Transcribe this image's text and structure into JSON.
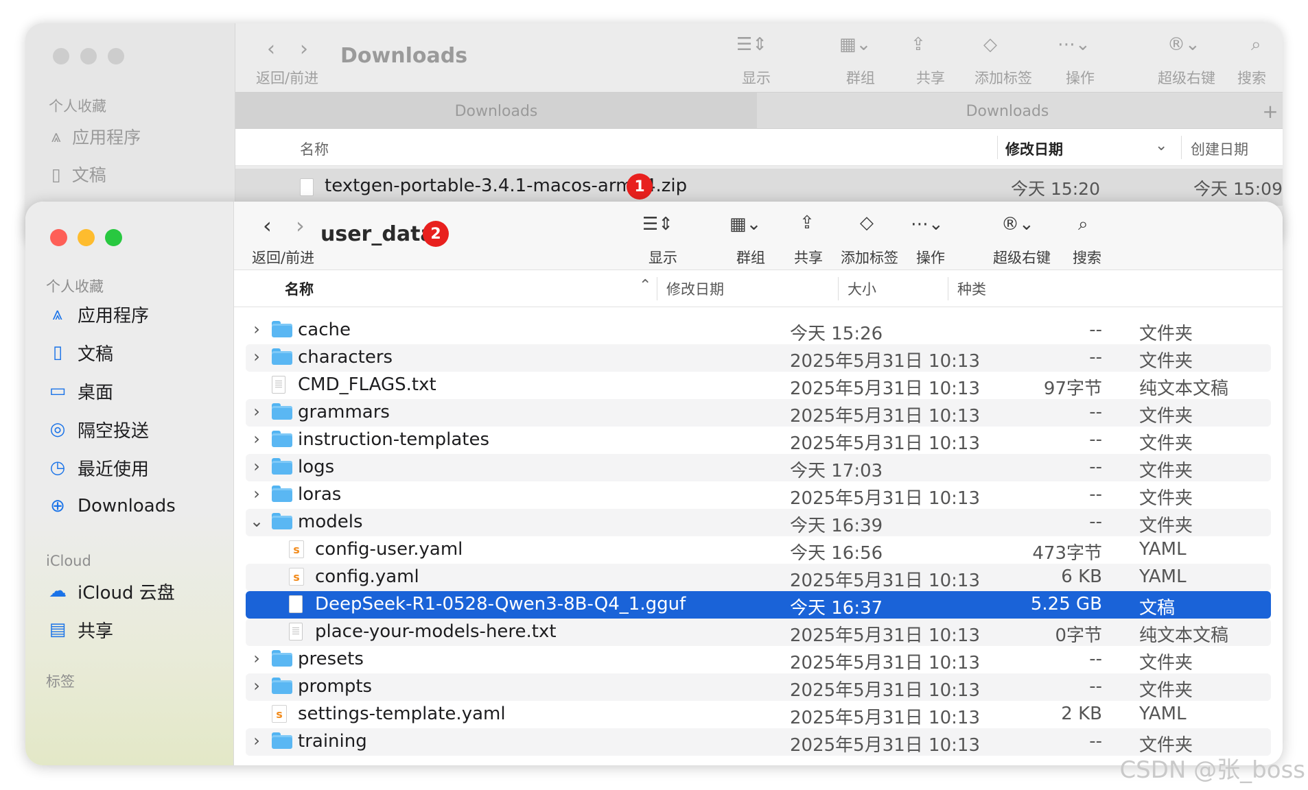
{
  "back_window": {
    "sidebar_heading": "个人收藏",
    "sidebar_items": [
      {
        "label": "应用程序",
        "icon": "apps-icon"
      },
      {
        "label": "文稿",
        "icon": "doc-icon"
      }
    ],
    "title": "Downloads",
    "nav_label": "返回/前进",
    "toolbar": [
      "显示",
      "群组",
      "共享",
      "添加标签",
      "操作",
      "超级右键",
      "搜索"
    ],
    "tabs": [
      "Downloads",
      "Downloads"
    ],
    "add_tab": "+",
    "columns": {
      "name": "名称",
      "modified": "修改日期",
      "created": "创建日期"
    },
    "row": {
      "name": "textgen-portable-3.4.1-macos-arm64.zip",
      "modified": "今天 15:20",
      "created": "今天 15:09"
    },
    "badge": "1"
  },
  "front_window": {
    "sidebar": {
      "favorites_heading": "个人收藏",
      "favorites": [
        {
          "label": "应用程序",
          "icon": "apps-icon"
        },
        {
          "label": "文稿",
          "icon": "doc-icon"
        },
        {
          "label": "桌面",
          "icon": "desktop-icon"
        },
        {
          "label": "隔空投送",
          "icon": "airdrop-icon"
        },
        {
          "label": "最近使用",
          "icon": "clock-icon"
        },
        {
          "label": "Downloads",
          "icon": "download-icon"
        }
      ],
      "icloud_heading": "iCloud",
      "icloud": [
        {
          "label": "iCloud 云盘",
          "icon": "cloud-icon"
        },
        {
          "label": "共享",
          "icon": "shared-folder-icon"
        }
      ],
      "tags_heading": "标签"
    },
    "title": "user_data",
    "badge": "2",
    "nav_label": "返回/前进",
    "toolbar": [
      "显示",
      "群组",
      "共享",
      "添加标签",
      "操作",
      "超级右键",
      "搜索"
    ],
    "columns": {
      "name": "名称",
      "modified": "修改日期",
      "size": "大小",
      "kind": "种类"
    },
    "rows": [
      {
        "name": "cache",
        "modified": "今天 15:26",
        "size": "--",
        "kind": "文件夹",
        "type": "folder",
        "depth": 0,
        "expand": "collapsed"
      },
      {
        "name": "characters",
        "modified": "2025年5月31日 10:13",
        "size": "--",
        "kind": "文件夹",
        "type": "folder",
        "depth": 0,
        "expand": "collapsed"
      },
      {
        "name": "CMD_FLAGS.txt",
        "modified": "2025年5月31日 10:13",
        "size": "97字节",
        "kind": "纯文本文稿",
        "type": "txt",
        "depth": 0,
        "expand": "none"
      },
      {
        "name": "grammars",
        "modified": "2025年5月31日 10:13",
        "size": "--",
        "kind": "文件夹",
        "type": "folder",
        "depth": 0,
        "expand": "collapsed"
      },
      {
        "name": "instruction-templates",
        "modified": "2025年5月31日 10:13",
        "size": "--",
        "kind": "文件夹",
        "type": "folder",
        "depth": 0,
        "expand": "collapsed"
      },
      {
        "name": "logs",
        "modified": "今天 17:03",
        "size": "--",
        "kind": "文件夹",
        "type": "folder",
        "depth": 0,
        "expand": "collapsed"
      },
      {
        "name": "loras",
        "modified": "2025年5月31日 10:13",
        "size": "--",
        "kind": "文件夹",
        "type": "folder",
        "depth": 0,
        "expand": "collapsed"
      },
      {
        "name": "models",
        "modified": "今天 16:39",
        "size": "--",
        "kind": "文件夹",
        "type": "folder",
        "depth": 0,
        "expand": "expanded"
      },
      {
        "name": "config-user.yaml",
        "modified": "今天 16:56",
        "size": "473字节",
        "kind": "YAML",
        "type": "yaml",
        "depth": 1,
        "expand": "none"
      },
      {
        "name": "config.yaml",
        "modified": "2025年5月31日 10:13",
        "size": "6 KB",
        "kind": "YAML",
        "type": "yaml",
        "depth": 1,
        "expand": "none"
      },
      {
        "name": "DeepSeek-R1-0528-Qwen3-8B-Q4_1.gguf",
        "modified": "今天 16:37",
        "size": "5.25 GB",
        "kind": "文稿",
        "type": "doc",
        "depth": 1,
        "expand": "none",
        "selected": true
      },
      {
        "name": "place-your-models-here.txt",
        "modified": "2025年5月31日 10:13",
        "size": "0字节",
        "kind": "纯文本文稿",
        "type": "txt",
        "depth": 1,
        "expand": "none"
      },
      {
        "name": "presets",
        "modified": "2025年5月31日 10:13",
        "size": "--",
        "kind": "文件夹",
        "type": "folder",
        "depth": 0,
        "expand": "collapsed"
      },
      {
        "name": "prompts",
        "modified": "2025年5月31日 10:13",
        "size": "--",
        "kind": "文件夹",
        "type": "folder",
        "depth": 0,
        "expand": "collapsed"
      },
      {
        "name": "settings-template.yaml",
        "modified": "2025年5月31日 10:13",
        "size": "2 KB",
        "kind": "YAML",
        "type": "yaml",
        "depth": 0,
        "expand": "none"
      },
      {
        "name": "training",
        "modified": "2025年5月31日 10:13",
        "size": "--",
        "kind": "文件夹",
        "type": "folder",
        "depth": 0,
        "expand": "collapsed"
      }
    ]
  },
  "watermark": "CSDN @张_boss",
  "colors": {
    "selection": "#1a63d8",
    "badge": "#e8201e",
    "folder": "#5ab7f3",
    "close": "#fe5f57",
    "minimize": "#febc2e",
    "zoom": "#28c840"
  }
}
